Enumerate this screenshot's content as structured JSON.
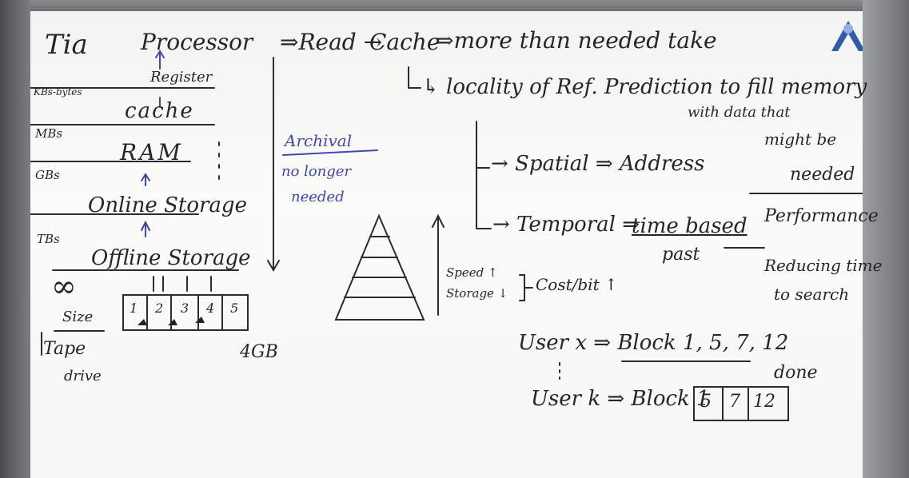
{
  "board": {
    "corner_note": "Tia",
    "hierarchy": {
      "register": "Register",
      "register_size": "KBs-bytes",
      "cache": "cache",
      "cache_size": "MBs",
      "ram": "RAM",
      "ram_size": "GBs",
      "online_storage": "Online Storage",
      "online_size": "TBs",
      "offline_storage": "Offline Storage",
      "offline_size": "∞",
      "size_label": "Size",
      "tape": "Tape",
      "drive": "drive",
      "blocks": [
        "1",
        "2",
        "3",
        "4",
        "5"
      ],
      "block_capacity": "4GB"
    },
    "flow": {
      "processor": "Processor",
      "read": "⇒Read →",
      "cache": "Cache",
      "more": "⇒more than needed take",
      "locality": "↳ locality of Ref. Prediction to fill memory",
      "with_data": "with data that",
      "might_be": "might be",
      "needed": "needed",
      "archival": "Archival",
      "no_longer": "no longer",
      "no_longer_needed": "needed"
    },
    "locality": {
      "spatial": "→ Spatial ⇒ Address",
      "temporal": "→ Temporal ⇒",
      "time_based": "time based",
      "past": "past",
      "performance": "Performance",
      "reducing": "Reducing time",
      "to_search": "to search"
    },
    "pyramid": {
      "speed": "Speed ↑",
      "storage": "Storage ↓",
      "cost": "Cost/bit ↑"
    },
    "users": {
      "userx": "User x ⇒ Block 1, 5, 7, 12",
      "done": "done",
      "userk": "User k ⇒ Block 1",
      "kblocks": [
        "5",
        "7",
        "12"
      ]
    }
  }
}
